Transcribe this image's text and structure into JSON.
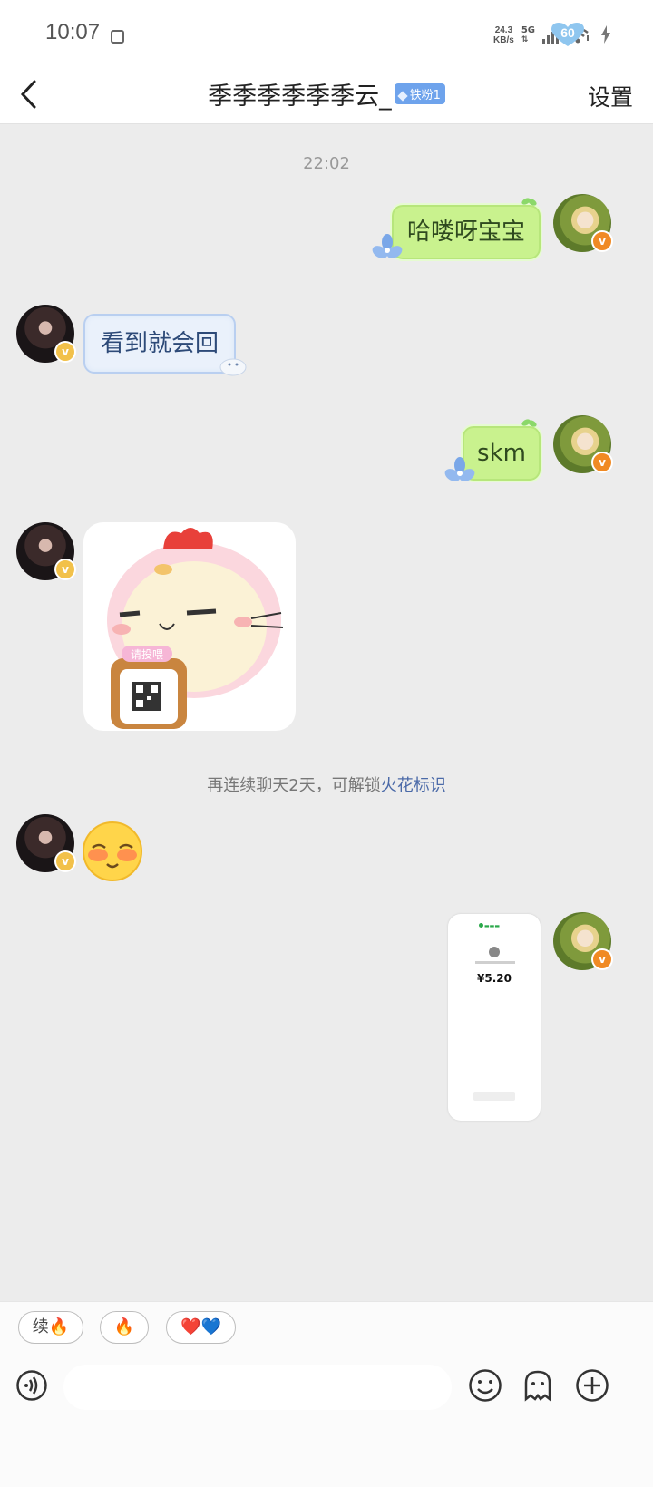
{
  "status_bar": {
    "time": "10:07",
    "net_speed_top": "24.3",
    "net_speed_bottom": "KB/s",
    "network_type": "5G",
    "battery_level": "60"
  },
  "header": {
    "title": "季季季季季季云_",
    "fan_badge": "铁粉1",
    "settings_label": "设置"
  },
  "chat": {
    "timestamp": "22:02",
    "messages": [
      {
        "from": "me",
        "text": "哈喽呀宝宝"
      },
      {
        "from": "other",
        "text": "看到就会回"
      },
      {
        "from": "me",
        "text": "skm"
      },
      {
        "from": "other",
        "type": "sticker"
      },
      {
        "from": "other",
        "type": "emoji"
      },
      {
        "from": "me",
        "type": "payment-screenshot"
      }
    ],
    "sticker_caption": "请投喂",
    "system_note_prefix": "再连续聊天2天，可解锁",
    "system_note_link": "火花标识",
    "receipt_amount": "¥5.20"
  },
  "quick_replies": [
    "续🔥",
    "🔥",
    "❤️💙"
  ],
  "input": {
    "placeholder": ""
  },
  "colors": {
    "me_bubble": "#c9f28e",
    "other_bubble": "#eaf1fb",
    "background": "#ececec",
    "badge": "#6ea3ec",
    "link": "#4b6aa8"
  }
}
